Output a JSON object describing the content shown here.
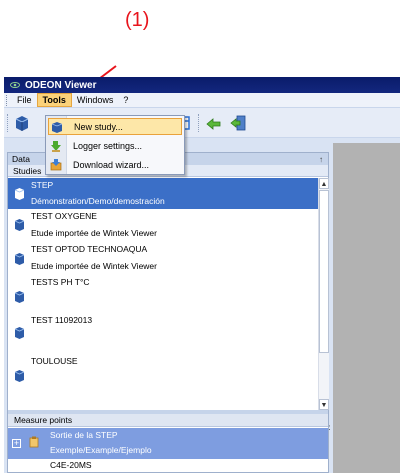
{
  "annotation": {
    "label": "(1)",
    "color": "#e8141c"
  },
  "window": {
    "title": "ODEON Viewer"
  },
  "menu": {
    "items": [
      "File",
      "Tools",
      "Windows",
      "?"
    ],
    "active": "Tools"
  },
  "tools_menu": {
    "items": [
      "New study...",
      "Logger settings...",
      "Download wizard..."
    ],
    "highlighted": "New study..."
  },
  "data_panel": {
    "title": "Data",
    "pin_glyph": "↑",
    "studies_header": "Studies",
    "studies": [
      {
        "name": "STEP",
        "description": "Démonstration/Demo/demostración",
        "selected": true
      },
      {
        "name": "TEST OXYGENE",
        "description": "Etude importée de Wintek Viewer",
        "selected": false
      },
      {
        "name": "TEST OPTOD TECHNOAQUA",
        "description": "Etude importée de Wintek Viewer",
        "selected": false
      },
      {
        "name": "TESTS PH T°C",
        "description": "",
        "selected": false
      },
      {
        "name": "TEST 11092013",
        "description": "",
        "selected": false
      },
      {
        "name": "TOULOUSE",
        "description": "",
        "selected": false
      }
    ],
    "splitter_grip": "::",
    "measure_points_header": "Measure points",
    "measure_points": [
      {
        "name": "Sortie de la STEP",
        "description": "Exemple/Example/Ejemplo",
        "selected": true
      },
      {
        "name": "C4E-20MS",
        "description": "",
        "selected": false
      }
    ]
  },
  "colors": {
    "accent": "#3b6fc7",
    "titlebar": "#0a1c6a",
    "menu_highlight": "#fbd27a"
  }
}
